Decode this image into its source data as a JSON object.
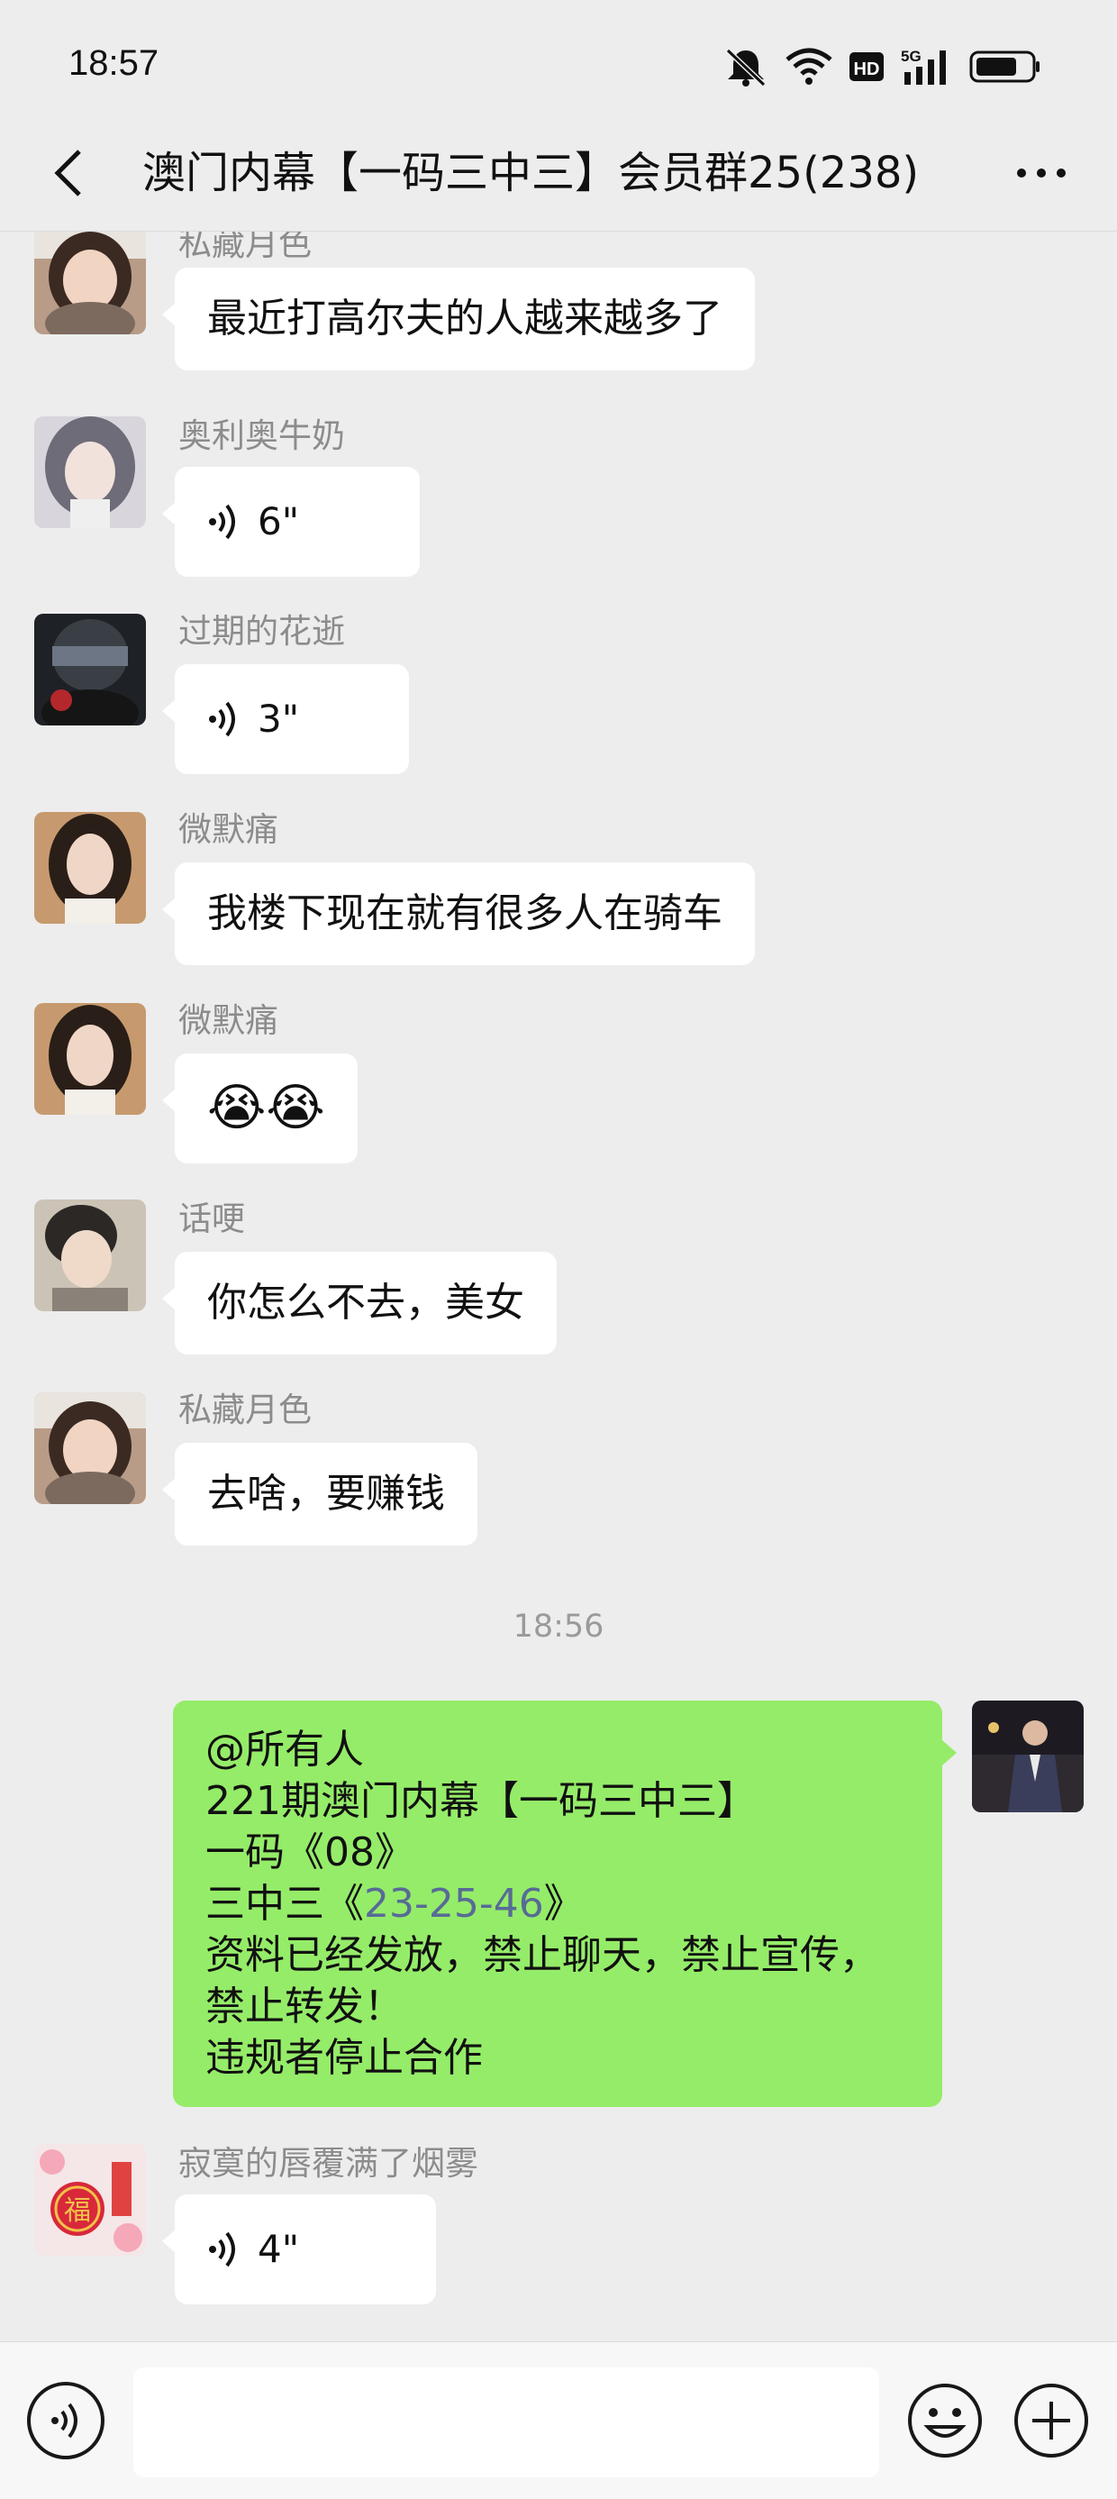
{
  "status_bar": {
    "time": "18:57",
    "icons": [
      "mute-bell-icon",
      "wifi-icon",
      "hd-icon",
      "5g-signal-icon",
      "battery-icon"
    ],
    "hd_label": "HD",
    "network_label": "5G"
  },
  "header": {
    "title": "澳门内幕【一码三中三】会员群25(238)",
    "back_icon": "chevron-left-icon",
    "more_icon": "more-dots-icon"
  },
  "messages": [
    {
      "type": "text",
      "sender": "私藏月色",
      "text": "最近打高尔夫的人越来越多了"
    },
    {
      "type": "voice",
      "sender": "奥利奥牛奶",
      "duration": "6\""
    },
    {
      "type": "voice",
      "sender": "过期的花逝",
      "duration": "3\""
    },
    {
      "type": "text",
      "sender": "微默痛",
      "text": "我楼下现在就有很多人在骑车"
    },
    {
      "type": "emoji",
      "sender": "微默痛",
      "emoji": "😭😭"
    },
    {
      "type": "text",
      "sender": "话哽",
      "text": "你怎么不去，美女"
    },
    {
      "type": "text",
      "sender": "私藏月色",
      "text": "去啥，要赚钱"
    }
  ],
  "timestamp": "18:56",
  "my_message": {
    "line1": "@所有人",
    "line2": "221期澳门内幕【一码三中三】",
    "line3": "一码《08》",
    "line4_prefix": "三中三《",
    "line4_link": "23-25-46",
    "line4_suffix": "》",
    "line5": "资料已经发放，禁止聊天，禁止宣传，",
    "line6": "禁止转发！",
    "line7": "违规者停止合作"
  },
  "last_message": {
    "type": "voice",
    "sender": "寂寞的唇覆满了烟雾",
    "duration": "4\""
  },
  "input_bar": {
    "voice_icon": "voice-mode-icon",
    "emoji_icon": "emoji-icon",
    "plus_icon": "plus-icon"
  },
  "colors": {
    "background": "#ededed",
    "my_bubble": "#95ec69",
    "link": "#576b95",
    "nickname": "#8c8c8c"
  }
}
